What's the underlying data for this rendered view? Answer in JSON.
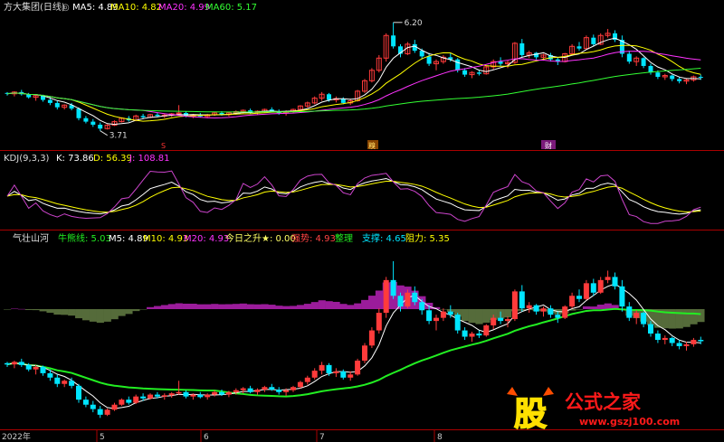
{
  "top_header": {
    "title": "方大集团(日线)",
    "ma5": "MA5: 4.89",
    "ma10": "MA10: 4.82",
    "ma20": "MA20: 4.99",
    "ma60": "MA60: 5.17"
  },
  "mid_header": {
    "title": "KDJ(9,3,3)",
    "k": "K: 73.86",
    "d": "D: 56.39",
    "j": "J: 108.81"
  },
  "bot_header": {
    "title": "气壮山河",
    "bull": "牛熊线: 5.03",
    "m5": "M5: 4.89",
    "m10": "M10: 4.93",
    "m20": "M20: 4.93",
    "today": "今日之升★: 0.00",
    "strong": "强势: 4.93",
    "consol": "整理",
    "support": "支撑: 4.65",
    "resist": "阻力: 5.35"
  },
  "annotations": {
    "high": "6.20",
    "low": "3.71"
  },
  "markers": {
    "s": "S",
    "m1": "糗",
    "m2": "财"
  },
  "xaxis": {
    "y2022": "2022年",
    "m5": "5",
    "m6": "6",
    "m7": "7",
    "m8": "8"
  },
  "watermark": {
    "logo": "股",
    "brand": "公式之家",
    "url": "www.gszj100.com"
  },
  "colors": {
    "background": "#000000",
    "up": "#ff3b3b",
    "down": "#00e5ff",
    "ma5": "#ffffff",
    "ma10": "#ffff00",
    "ma20": "#ff33ff",
    "ma60": "#33ff33",
    "divider": "#aa0000",
    "bull_line": "#22ee22",
    "hist_pos": "#9b1c9b",
    "hist_neg": "#556b3a"
  },
  "chart_data": {
    "type": "candlestick",
    "x_start": "2022-04-19",
    "x_months": [
      "2022-05",
      "2022-06",
      "2022-07",
      "2022-08"
    ],
    "ohlc": [
      [
        4.58,
        4.6,
        4.52,
        4.56
      ],
      [
        4.56,
        4.62,
        4.5,
        4.6
      ],
      [
        4.6,
        4.65,
        4.52,
        4.55
      ],
      [
        4.55,
        4.58,
        4.45,
        4.48
      ],
      [
        4.48,
        4.55,
        4.4,
        4.52
      ],
      [
        4.52,
        4.54,
        4.38,
        4.42
      ],
      [
        4.42,
        4.48,
        4.3,
        4.35
      ],
      [
        4.35,
        4.4,
        4.2,
        4.25
      ],
      [
        4.25,
        4.32,
        4.2,
        4.3
      ],
      [
        4.3,
        4.35,
        4.18,
        4.22
      ],
      [
        4.22,
        4.25,
        3.95,
        4.0
      ],
      [
        4.0,
        4.05,
        3.88,
        3.92
      ],
      [
        3.92,
        3.98,
        3.8,
        3.85
      ],
      [
        3.85,
        3.9,
        3.71,
        3.76
      ],
      [
        3.76,
        3.86,
        3.74,
        3.84
      ],
      [
        3.84,
        3.95,
        3.82,
        3.92
      ],
      [
        3.92,
        4.02,
        3.9,
        4.0
      ],
      [
        4.0,
        4.05,
        3.92,
        3.95
      ],
      [
        3.95,
        4.08,
        3.93,
        4.05
      ],
      [
        4.05,
        4.1,
        3.98,
        4.02
      ],
      [
        4.02,
        4.1,
        4.0,
        4.08
      ],
      [
        4.08,
        4.12,
        4.02,
        4.05
      ],
      [
        4.05,
        4.1,
        4.0,
        4.07
      ],
      [
        4.07,
        4.12,
        4.03,
        4.1
      ],
      [
        4.1,
        4.3,
        4.08,
        4.12
      ],
      [
        4.12,
        4.15,
        4.02,
        4.05
      ],
      [
        4.05,
        4.1,
        4.0,
        4.08
      ],
      [
        4.08,
        4.12,
        4.02,
        4.04
      ],
      [
        4.04,
        4.1,
        4.0,
        4.08
      ],
      [
        4.08,
        4.15,
        4.05,
        4.12
      ],
      [
        4.12,
        4.16,
        4.06,
        4.08
      ],
      [
        4.08,
        4.14,
        4.04,
        4.12
      ],
      [
        4.12,
        4.18,
        4.08,
        4.15
      ],
      [
        4.15,
        4.2,
        4.1,
        4.18
      ],
      [
        4.18,
        4.22,
        4.1,
        4.12
      ],
      [
        4.12,
        4.18,
        4.08,
        4.16
      ],
      [
        4.16,
        4.22,
        4.12,
        4.2
      ],
      [
        4.2,
        4.25,
        4.14,
        4.16
      ],
      [
        4.16,
        4.2,
        4.08,
        4.12
      ],
      [
        4.12,
        4.18,
        4.06,
        4.15
      ],
      [
        4.15,
        4.22,
        4.12,
        4.2
      ],
      [
        4.2,
        4.3,
        4.18,
        4.28
      ],
      [
        4.28,
        4.38,
        4.24,
        4.35
      ],
      [
        4.35,
        4.5,
        4.32,
        4.46
      ],
      [
        4.46,
        4.6,
        4.4,
        4.55
      ],
      [
        4.55,
        4.58,
        4.38,
        4.42
      ],
      [
        4.42,
        4.5,
        4.36,
        4.45
      ],
      [
        4.45,
        4.48,
        4.32,
        4.35
      ],
      [
        4.35,
        4.45,
        4.3,
        4.4
      ],
      [
        4.4,
        4.65,
        4.38,
        4.62
      ],
      [
        4.62,
        4.9,
        4.58,
        4.86
      ],
      [
        4.86,
        5.15,
        4.82,
        5.1
      ],
      [
        5.1,
        5.45,
        5.05,
        5.38
      ],
      [
        5.38,
        5.95,
        5.3,
        5.9
      ],
      [
        5.9,
        6.2,
        5.6,
        5.65
      ],
      [
        5.65,
        5.7,
        5.4,
        5.48
      ],
      [
        5.48,
        5.75,
        5.45,
        5.7
      ],
      [
        5.7,
        5.8,
        5.5,
        5.55
      ],
      [
        5.55,
        5.6,
        5.35,
        5.42
      ],
      [
        5.42,
        5.5,
        5.2,
        5.25
      ],
      [
        5.25,
        5.35,
        5.1,
        5.3
      ],
      [
        5.3,
        5.45,
        5.25,
        5.4
      ],
      [
        5.4,
        5.5,
        5.3,
        5.35
      ],
      [
        5.35,
        5.38,
        5.05,
        5.1
      ],
      [
        5.1,
        5.15,
        4.95,
        5.0
      ],
      [
        5.0,
        5.08,
        4.92,
        5.05
      ],
      [
        5.05,
        5.1,
        4.98,
        5.02
      ],
      [
        5.02,
        5.2,
        5.0,
        5.18
      ],
      [
        5.18,
        5.35,
        5.12,
        5.3
      ],
      [
        5.3,
        5.4,
        5.2,
        5.25
      ],
      [
        5.25,
        5.32,
        5.15,
        5.28
      ],
      [
        5.28,
        5.75,
        5.25,
        5.72
      ],
      [
        5.72,
        5.82,
        5.4,
        5.45
      ],
      [
        5.45,
        5.55,
        5.38,
        5.5
      ],
      [
        5.5,
        5.52,
        5.35,
        5.4
      ],
      [
        5.4,
        5.48,
        5.32,
        5.45
      ],
      [
        5.45,
        5.5,
        5.3,
        5.35
      ],
      [
        5.35,
        5.4,
        5.22,
        5.3
      ],
      [
        5.3,
        5.5,
        5.28,
        5.48
      ],
      [
        5.48,
        5.7,
        5.45,
        5.65
      ],
      [
        5.65,
        5.75,
        5.55,
        5.6
      ],
      [
        5.6,
        5.9,
        5.58,
        5.85
      ],
      [
        5.85,
        5.92,
        5.65,
        5.7
      ],
      [
        5.7,
        5.95,
        5.68,
        5.9
      ],
      [
        5.9,
        6.05,
        5.85,
        5.95
      ],
      [
        5.95,
        6.02,
        5.75,
        5.8
      ],
      [
        5.8,
        5.9,
        5.4,
        5.48
      ],
      [
        5.48,
        5.55,
        5.25,
        5.3
      ],
      [
        5.3,
        5.42,
        5.2,
        5.38
      ],
      [
        5.38,
        5.4,
        5.15,
        5.2
      ],
      [
        5.2,
        5.25,
        5.0,
        5.05
      ],
      [
        5.05,
        5.1,
        4.9,
        4.95
      ],
      [
        4.95,
        5.02,
        4.88,
        4.98
      ],
      [
        4.98,
        5.0,
        4.85,
        4.9
      ],
      [
        4.9,
        4.95,
        4.8,
        4.85
      ],
      [
        4.85,
        4.92,
        4.78,
        4.88
      ],
      [
        4.88,
        4.98,
        4.84,
        4.95
      ],
      [
        4.95,
        5.0,
        4.88,
        4.93
      ]
    ],
    "ma_labels": [
      "MA5",
      "MA10",
      "MA20",
      "MA60"
    ],
    "kdj_labels": [
      "K",
      "D",
      "J"
    ]
  }
}
